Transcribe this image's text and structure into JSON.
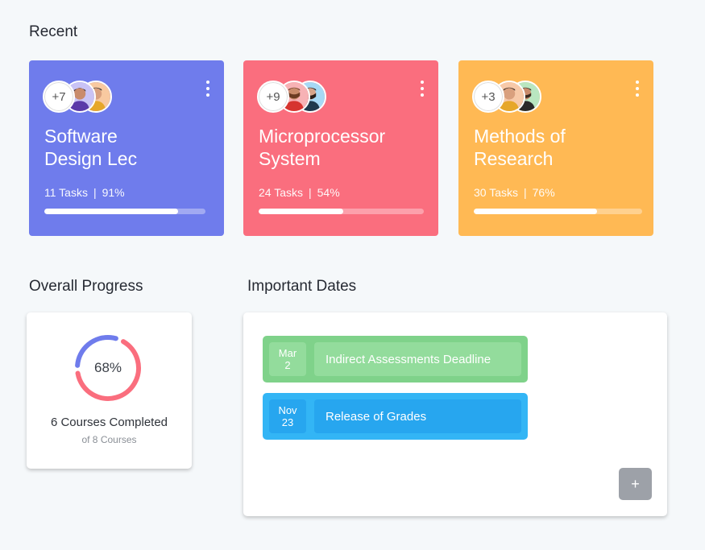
{
  "sections": {
    "recent": "Recent",
    "overall": "Overall Progress",
    "dates": "Important Dates"
  },
  "courses": [
    {
      "title_line1": "Software",
      "title_line2": "Design Lec",
      "tasks": "11 Tasks",
      "percent_label": "91%",
      "progress": 0.83,
      "extra_members": "+7",
      "color": "#6f7cec"
    },
    {
      "title_line1": "Microprocessor",
      "title_line2": "System",
      "tasks": "24 Tasks",
      "percent_label": "54%",
      "progress": 0.51,
      "extra_members": "+9",
      "color": "#fa6e7e"
    },
    {
      "title_line1": "Methods of",
      "title_line2": "Research",
      "tasks": "30 Tasks",
      "percent_label": "76%",
      "progress": 0.73,
      "extra_members": "+3",
      "color": "#ffb954"
    }
  ],
  "overall": {
    "percent_label": "68%",
    "percent": 0.68,
    "completed": "6 Courses Completed",
    "of_total": "of 8 Courses",
    "done_color": "#fa6e7e",
    "remaining_color": "#6f7cec"
  },
  "dates": [
    {
      "month": "Mar",
      "day": "2",
      "label": "Indirect Assessments Deadline",
      "color": "#7fd28a",
      "inner_color": "#93dc9c"
    },
    {
      "month": "Nov",
      "day": "23",
      "label": "Release of Grades",
      "color": "#33b5f5",
      "inner_color": "#27a6ef"
    }
  ],
  "add_button_label": "+"
}
